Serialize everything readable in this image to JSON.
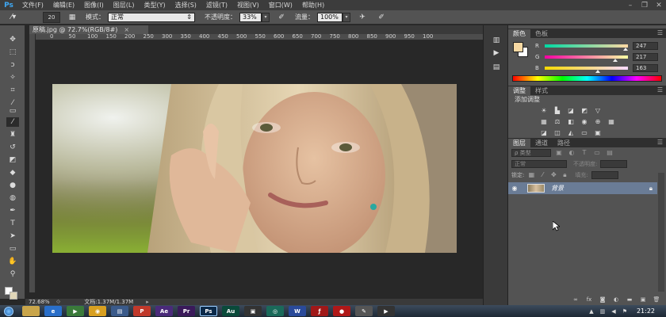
{
  "app": {
    "logo": "Ps"
  },
  "menubar": {
    "items": [
      "文件(F)",
      "编辑(E)",
      "图像(I)",
      "图层(L)",
      "类型(Y)",
      "选择(S)",
      "滤镜(T)",
      "视图(V)",
      "窗口(W)",
      "帮助(H)"
    ],
    "window_buttons": [
      "minimize-icon",
      "restore-icon",
      "close-icon"
    ]
  },
  "options": {
    "brush_size": "20",
    "mode_label": "模式：",
    "mode_value": "正常",
    "opacity_label": "不透明度：",
    "opacity_value": "33%",
    "flow_label": "流量：",
    "flow_value": "100%"
  },
  "document": {
    "tab_title": "原稿.jpg @ 72.7%(RGB/8#)",
    "tab_close": "×",
    "zoom": "72.68%",
    "doc_info": "文档:1.37M/1.37M"
  },
  "ruler": {
    "top_ticks": [
      "0",
      "50",
      "100",
      "150",
      "200",
      "250",
      "300",
      "350",
      "400",
      "450",
      "500",
      "550",
      "600",
      "650",
      "700",
      "750",
      "800",
      "850",
      "900",
      "950",
      "100"
    ]
  },
  "color_panel": {
    "tabs": [
      "颜色",
      "色板"
    ],
    "r_label": "R",
    "g_label": "G",
    "b_label": "B",
    "r": "247",
    "g": "217",
    "b": "163",
    "r_fraction": 0.969,
    "g_fraction": 0.851,
    "b_fraction": 0.639,
    "foreground": "#f7d9a3",
    "background": "#ffffff"
  },
  "adjust_panel": {
    "tabs": [
      "调整",
      "样式"
    ],
    "title": "添加调整"
  },
  "layers_panel": {
    "tabs": [
      "图层",
      "通道",
      "路径"
    ],
    "filter_value": "ρ 类型",
    "blend_mode": "正常",
    "opacity_label": "不透明度:",
    "lock_label": "锁定:",
    "fill_label": "填充:",
    "layer_name": "背景"
  },
  "taskbar": {
    "apps": [
      {
        "name": "folder",
        "label": "",
        "color": "#c9a54a"
      },
      {
        "name": "ie",
        "label": "e",
        "color": "#2a6fc9"
      },
      {
        "name": "media",
        "label": "▶",
        "color": "#3a7a3a"
      },
      {
        "name": "chrome",
        "label": "◉",
        "color": "#d9a020"
      },
      {
        "name": "explorer",
        "label": "▤",
        "color": "#3a5a8a"
      },
      {
        "name": "ppt",
        "label": "P",
        "color": "#c0392b"
      },
      {
        "name": "ae",
        "label": "Ae",
        "color": "#4a2a7a"
      },
      {
        "name": "pr",
        "label": "Pr",
        "color": "#3a1a5a"
      },
      {
        "name": "ps",
        "label": "Ps",
        "color": "#0b2a4a"
      },
      {
        "name": "au",
        "label": "Au",
        "color": "#0a4a3a"
      },
      {
        "name": "screen",
        "label": "▣",
        "color": "#333"
      },
      {
        "name": "camera",
        "label": "◎",
        "color": "#1a6a5a"
      },
      {
        "name": "wps",
        "label": "W",
        "color": "#2a4a9a"
      },
      {
        "name": "flash",
        "label": "ƒ",
        "color": "#a01818"
      },
      {
        "name": "recorder",
        "label": "●",
        "color": "#b01818"
      },
      {
        "name": "pen",
        "label": "✎",
        "color": "#555"
      },
      {
        "name": "video",
        "label": "▶",
        "color": "#333"
      }
    ],
    "clock": "21:22"
  }
}
